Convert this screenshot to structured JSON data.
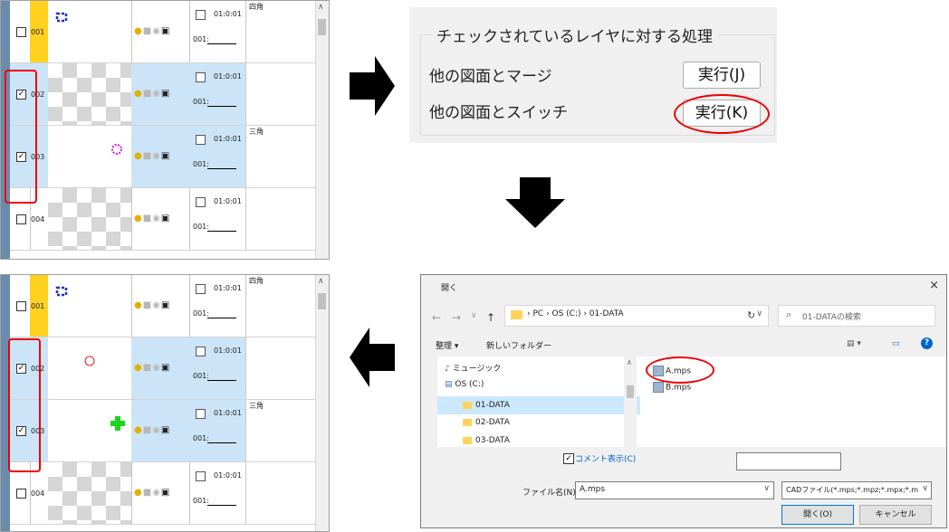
{
  "top_panel": {
    "rows": [
      {
        "id": "001",
        "checked": false,
        "selected": false,
        "time": "01:0:01",
        "field_label": "001:",
        "name": "四角"
      },
      {
        "id": "002",
        "checked": true,
        "selected": true,
        "time": "01:0:01",
        "field_label": "001:",
        "name": ""
      },
      {
        "id": "003",
        "checked": true,
        "selected": true,
        "time": "01:0:01",
        "field_label": "001:",
        "name": "三角"
      },
      {
        "id": "004",
        "checked": false,
        "selected": false,
        "time": "01:0:01",
        "field_label": "001:",
        "name": ""
      }
    ]
  },
  "bottom_panel": {
    "rows": [
      {
        "id": "001",
        "checked": false,
        "selected": false,
        "time": "01:0:01",
        "field_label": "001:",
        "name": "四角"
      },
      {
        "id": "002",
        "checked": true,
        "selected": true,
        "time": "01:0:01",
        "field_label": "001:",
        "name": ""
      },
      {
        "id": "003",
        "checked": true,
        "selected": true,
        "time": "01:0:01",
        "field_label": "001:",
        "name": "三角"
      },
      {
        "id": "004",
        "checked": false,
        "selected": false,
        "time": "01:0:01",
        "field_label": "001:",
        "name": ""
      }
    ]
  },
  "process_panel": {
    "title": "チェックされているレイヤに対する処理",
    "merge_label": "他の図面とマージ",
    "merge_button": "実行(J)",
    "switch_label": "他の図面とスイッチ",
    "switch_button": "実行(K)"
  },
  "open_dialog": {
    "title": "開く",
    "close": "×",
    "back": "←",
    "forward": "→",
    "history": "∨",
    "up": "↑",
    "breadcrumbs": "›  PC  ›  OS (C:)  ›  01-DATA",
    "refresh": "↻",
    "search_placeholder": "01-DATAの検索",
    "organize": "整理 ▾",
    "new_folder": "新しいフォルダー",
    "nav_items": [
      {
        "label": "ミュージック",
        "icon": "music-icon"
      },
      {
        "label": "OS (C:)",
        "icon": "drive-icon"
      },
      {
        "label": "01-DATA",
        "icon": "folder-icon"
      },
      {
        "label": "02-DATA",
        "icon": "folder-icon"
      },
      {
        "label": "03-DATA",
        "icon": "folder-icon"
      }
    ],
    "files": [
      "A.mps",
      "B.mps"
    ],
    "comment_label": "コメント表示(C)",
    "filename_label": "ファイル名(N):",
    "filename_value": "A.mps",
    "filetype_value": "CADファイル(*.mps;*.mpz;*.mpx;*.m",
    "open_button": "開く(O)",
    "cancel_button": "キャンセル"
  }
}
